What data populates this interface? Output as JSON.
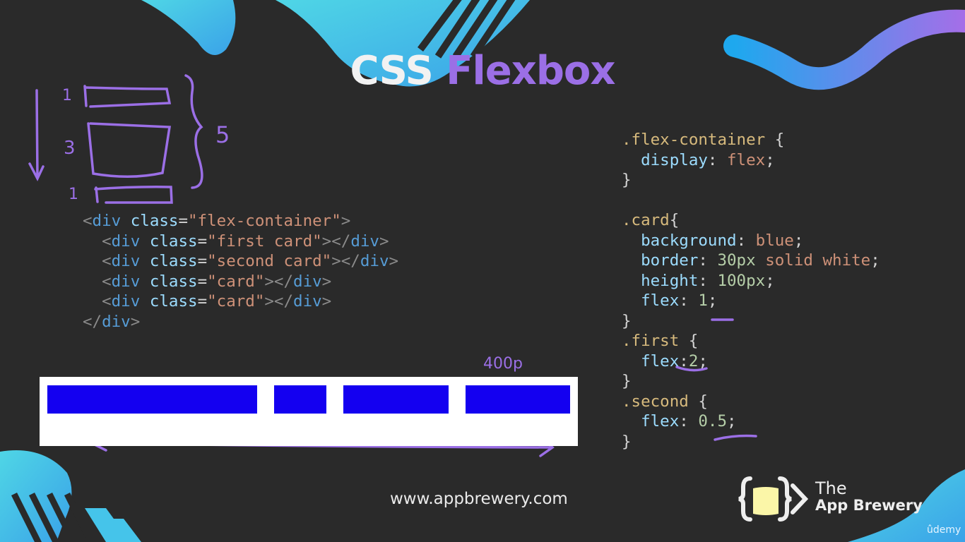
{
  "title": {
    "part1": "CSS",
    "part2": "Flexbox"
  },
  "colors": {
    "accent": "#9b6fe6",
    "card_blue": "#1400f0",
    "background": "#2a2a2a"
  },
  "html_code": [
    [
      [
        "punc",
        "<"
      ],
      [
        "tag",
        "div"
      ],
      [
        "plain",
        " "
      ],
      [
        "attr",
        "class"
      ],
      [
        "plain",
        "="
      ],
      [
        "str",
        "\"flex-container\""
      ],
      [
        "punc",
        ">"
      ]
    ],
    [
      [
        "plain",
        "  "
      ],
      [
        "punc",
        "<"
      ],
      [
        "tag",
        "div"
      ],
      [
        "plain",
        " "
      ],
      [
        "attr",
        "class"
      ],
      [
        "plain",
        "="
      ],
      [
        "str",
        "\"first card\""
      ],
      [
        "punc",
        "></"
      ],
      [
        "tag",
        "div"
      ],
      [
        "punc",
        ">"
      ]
    ],
    [
      [
        "plain",
        "  "
      ],
      [
        "punc",
        "<"
      ],
      [
        "tag",
        "div"
      ],
      [
        "plain",
        " "
      ],
      [
        "attr",
        "class"
      ],
      [
        "plain",
        "="
      ],
      [
        "str",
        "\"second card\""
      ],
      [
        "punc",
        "></"
      ],
      [
        "tag",
        "div"
      ],
      [
        "punc",
        ">"
      ]
    ],
    [
      [
        "plain",
        "  "
      ],
      [
        "punc",
        "<"
      ],
      [
        "tag",
        "div"
      ],
      [
        "plain",
        " "
      ],
      [
        "attr",
        "class"
      ],
      [
        "plain",
        "="
      ],
      [
        "str",
        "\"card\""
      ],
      [
        "punc",
        "></"
      ],
      [
        "tag",
        "div"
      ],
      [
        "punc",
        ">"
      ]
    ],
    [
      [
        "plain",
        "  "
      ],
      [
        "punc",
        "<"
      ],
      [
        "tag",
        "div"
      ],
      [
        "plain",
        " "
      ],
      [
        "attr",
        "class"
      ],
      [
        "plain",
        "="
      ],
      [
        "str",
        "\"card\""
      ],
      [
        "punc",
        "></"
      ],
      [
        "tag",
        "div"
      ],
      [
        "punc",
        ">"
      ]
    ],
    [
      [
        "punc",
        "</"
      ],
      [
        "tag",
        "div"
      ],
      [
        "punc",
        ">"
      ]
    ]
  ],
  "css_code": [
    [
      [
        "sel",
        ".flex-container"
      ],
      [
        "plain",
        " {"
      ]
    ],
    [
      [
        "plain",
        "  "
      ],
      [
        "prop",
        "display"
      ],
      [
        "plain",
        ": "
      ],
      [
        "val",
        "flex"
      ],
      [
        "plain",
        ";"
      ]
    ],
    [
      [
        "plain",
        "}"
      ]
    ],
    [
      [
        "plain",
        ""
      ]
    ],
    [
      [
        "sel",
        ".card"
      ],
      [
        "plain",
        "{"
      ]
    ],
    [
      [
        "plain",
        "  "
      ],
      [
        "prop",
        "background"
      ],
      [
        "plain",
        ": "
      ],
      [
        "val",
        "blue"
      ],
      [
        "plain",
        ";"
      ]
    ],
    [
      [
        "plain",
        "  "
      ],
      [
        "prop",
        "border"
      ],
      [
        "plain",
        ": "
      ],
      [
        "num",
        "30px"
      ],
      [
        "plain",
        " "
      ],
      [
        "val",
        "solid white"
      ],
      [
        "plain",
        ";"
      ]
    ],
    [
      [
        "plain",
        "  "
      ],
      [
        "prop",
        "height"
      ],
      [
        "plain",
        ": "
      ],
      [
        "num",
        "100px"
      ],
      [
        "plain",
        ";"
      ]
    ],
    [
      [
        "plain",
        "  "
      ],
      [
        "prop",
        "flex"
      ],
      [
        "plain",
        ": "
      ],
      [
        "num",
        "1"
      ],
      [
        "plain",
        ";"
      ]
    ],
    [
      [
        "plain",
        "}"
      ]
    ],
    [
      [
        "sel",
        ".first"
      ],
      [
        "plain",
        " {"
      ]
    ],
    [
      [
        "plain",
        "  "
      ],
      [
        "prop",
        "flex"
      ],
      [
        "plain",
        ":"
      ],
      [
        "num",
        "2"
      ],
      [
        "plain",
        ";"
      ]
    ],
    [
      [
        "plain",
        "}"
      ]
    ],
    [
      [
        "sel",
        ".second"
      ],
      [
        "plain",
        " {"
      ]
    ],
    [
      [
        "plain",
        "  "
      ],
      [
        "prop",
        "flex"
      ],
      [
        "plain",
        ": "
      ],
      [
        "num",
        "0.5"
      ],
      [
        "plain",
        ";"
      ]
    ],
    [
      [
        "plain",
        "}"
      ]
    ]
  ],
  "annotations": {
    "top": "1",
    "middle": "3",
    "bottom": "1",
    "total": "5",
    "width_note": "400p"
  },
  "demo_cards": [
    {
      "name": "first-card",
      "flex": 2
    },
    {
      "name": "second-card",
      "flex": 0.5
    },
    {
      "name": "card",
      "flex": 1
    },
    {
      "name": "card",
      "flex": 1
    }
  ],
  "footer": {
    "url": "www.appbrewery.com",
    "brand_line1": "The",
    "brand_line2": "App Brewery",
    "platform": "ûdemy"
  }
}
